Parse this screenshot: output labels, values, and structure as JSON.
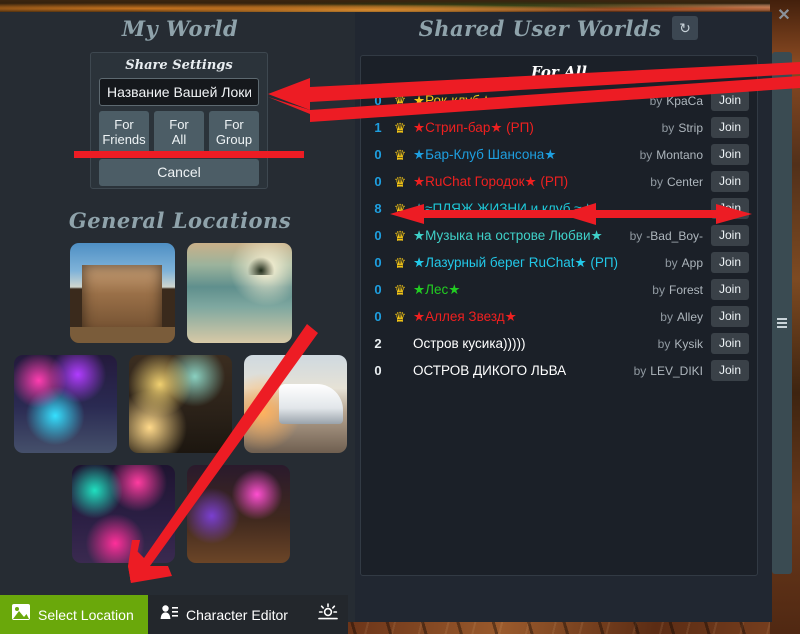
{
  "window": {
    "close_label": "✕"
  },
  "my_world": {
    "title": "My World",
    "share_panel": {
      "title": "Share Settings",
      "name_value": "Название Вашей Локи",
      "name_placeholder": "Название Вашей Локи",
      "buttons": [
        {
          "label": "For\nFriends"
        },
        {
          "label": "For\nAll"
        },
        {
          "label": "For\nGroup"
        }
      ],
      "cancel_label": "Cancel"
    }
  },
  "general_locations": {
    "title": "General Locations",
    "rows": [
      [
        {
          "name": "saloon-town",
          "style": "th-saloon"
        },
        {
          "name": "tropical-island",
          "style": "th-island"
        }
      ],
      [
        {
          "name": "beach-party",
          "style": "th-party"
        },
        {
          "name": "night-club",
          "style": "th-club"
        },
        {
          "name": "yacht",
          "style": "th-yacht"
        }
      ],
      [
        {
          "name": "disco-hall",
          "style": "th-disco"
        },
        {
          "name": "neon-bar",
          "style": "th-bar"
        }
      ]
    ]
  },
  "shared_worlds": {
    "title": "Shared User Worlds",
    "refresh_icon": "refresh-icon",
    "refresh_glyph": "↻",
    "section_header": "For All",
    "by_word": "by",
    "join_label": "Join",
    "crown_glyph": "♛",
    "rows": [
      {
        "count": "0",
        "crown": true,
        "name": "★Рок-клуб★",
        "color": "#f2c416",
        "author": "KpaCa"
      },
      {
        "count": "1",
        "crown": true,
        "name": "★Стрип-бар★ (РП)",
        "color": "#ef2020",
        "author": "Strip"
      },
      {
        "count": "0",
        "crown": true,
        "name": "★Бар-Клуб Шансона★",
        "color": "#1e9fe0",
        "author": "Montano"
      },
      {
        "count": "0",
        "crown": true,
        "name": "★RuChat Городок★ (РП)",
        "color": "#ef2020",
        "author": "Center"
      },
      {
        "count": "8",
        "crown": true,
        "name": "★≈ПЛЯЖ ЖИЗНИ и клуб ≈★",
        "color": "#1fc8d8",
        "author": ""
      },
      {
        "count": "0",
        "crown": true,
        "name": "★Музыка на острове Любви★",
        "color": "#3fd0c8",
        "author": "-Bad_Boy-"
      },
      {
        "count": "0",
        "crown": true,
        "name": "★Лазурный берег RuChat★ (РП)",
        "color": "#22c8e8",
        "author": "App"
      },
      {
        "count": "0",
        "crown": true,
        "name": "★Лес★",
        "color": "#22cc22",
        "author": "Forest"
      },
      {
        "count": "0",
        "crown": true,
        "name": "★Аллея Звезд★",
        "color": "#ef2020",
        "author": "Alley"
      },
      {
        "count": "2",
        "crown": false,
        "name": "Остров кусика)))))",
        "color": "#ffffff",
        "author": "Kysik"
      },
      {
        "count": "0",
        "crown": false,
        "name": "ОСТРОВ ДИКОГО ЛЬВА",
        "color": "#ffffff",
        "author": "LEV_DIKI"
      }
    ]
  },
  "toolbar": {
    "select_location_label": "Select Location",
    "select_location_icon": "picture-icon",
    "character_editor_label": "Character Editor",
    "character_editor_icon": "person-list-icon",
    "brightness_icon": "sun-icon"
  },
  "colors": {
    "accent_green": "#6aa80b",
    "panel_dark": "#1b2028",
    "panel_mid": "#212731",
    "button_slate": "#4c5d66",
    "count_blue": "#1e9fe0",
    "crown_gold": "#f2c416",
    "annotation_red": "#ed1c24"
  }
}
